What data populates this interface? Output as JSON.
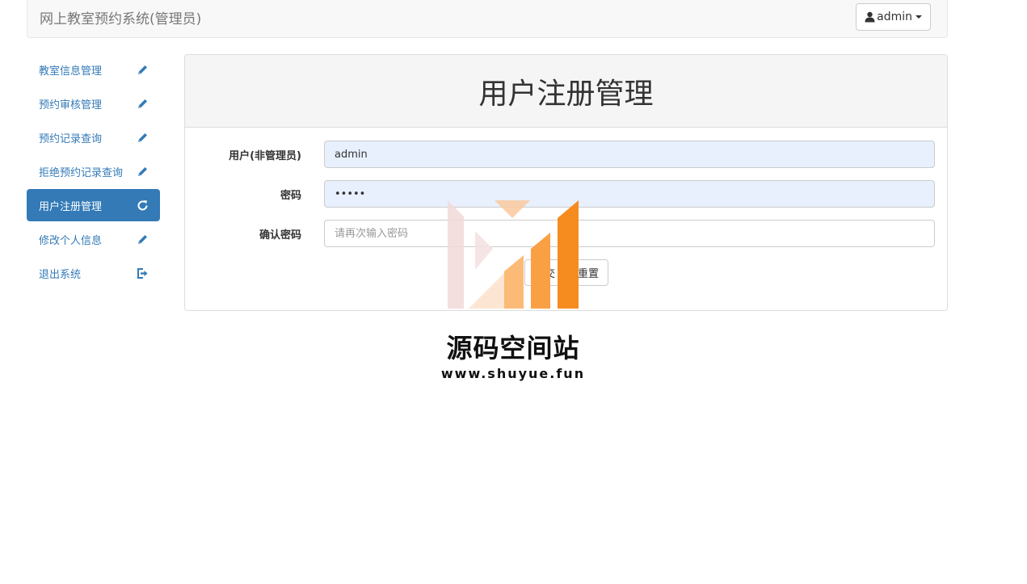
{
  "header": {
    "brand": "网上教室预约系统(管理员)",
    "user_label": "admin"
  },
  "sidebar": {
    "items": [
      {
        "label": "教室信息管理",
        "icon": "pencil-icon"
      },
      {
        "label": "预约审核管理",
        "icon": "pencil-icon"
      },
      {
        "label": "预约记录查询",
        "icon": "pencil-icon"
      },
      {
        "label": "拒绝预约记录查询",
        "icon": "pencil-icon"
      },
      {
        "label": "用户注册管理",
        "icon": "refresh-icon",
        "active": true
      },
      {
        "label": "修改个人信息",
        "icon": "pencil-icon"
      },
      {
        "label": "退出系统",
        "icon": "logout-icon"
      }
    ]
  },
  "panel": {
    "title": "用户注册管理"
  },
  "form": {
    "username_label": "用户(非管理员)",
    "username_value": "admin",
    "password_label": "密码",
    "password_value": "•••••",
    "confirm_label": "确认密码",
    "confirm_placeholder": "请再次输入密码",
    "submit_label": "提交",
    "reset_label": "重置"
  },
  "watermark": {
    "title": "源码空间站",
    "url": "www.shuyue.fun"
  },
  "colors": {
    "primary": "#337ab7",
    "watermark_orange": "#f68b1f"
  }
}
